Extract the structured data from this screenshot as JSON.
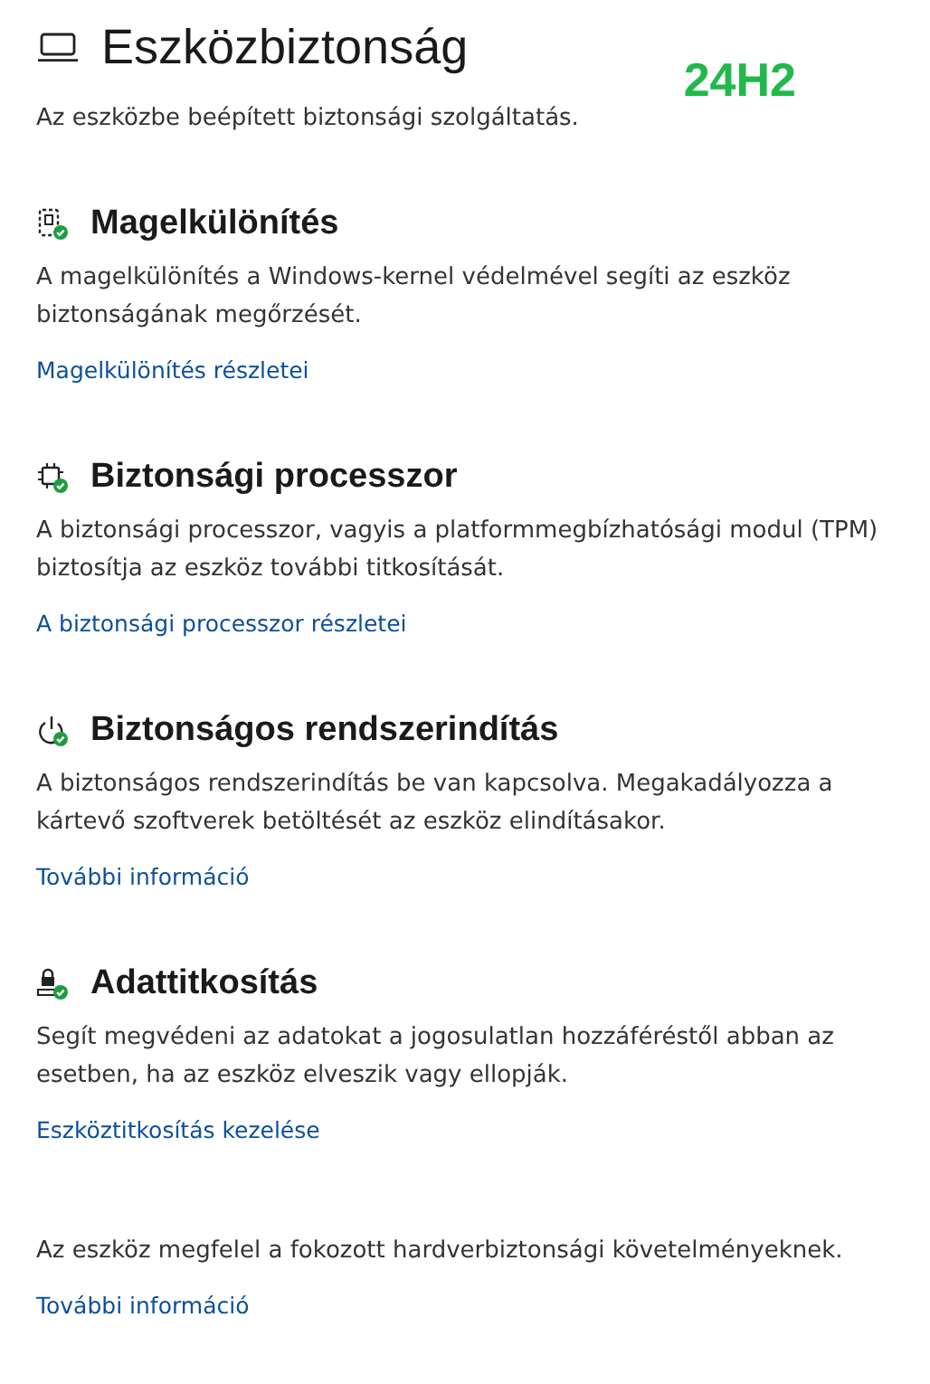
{
  "page": {
    "title": "Eszközbiztonság",
    "badge": "24H2",
    "subtitle": "Az eszközbe beépített biztonsági szolgáltatás."
  },
  "sections": [
    {
      "kind": "isolation",
      "heading": "Magelkülönítés",
      "description": "A magelkülönítés a Windows-kernel védelmével segíti az eszköz biztonságának megőrzését.",
      "link": "Magelkülönítés részletei"
    },
    {
      "kind": "processor",
      "heading": "Biztonsági processzor",
      "description": "A biztonsági processzor, vagyis a platformmegbízhatósági modul (TPM) biztosítja az eszköz további titkosítását.",
      "link": "A biztonsági processzor részletei"
    },
    {
      "kind": "boot",
      "heading": "Biztonságos rendszerindítás",
      "description": "A biztonságos rendszerindítás be van kapcsolva. Megakadályozza a kártevő szoftverek betöltését az eszköz elindításakor.",
      "link": "További információ"
    },
    {
      "kind": "encryption",
      "heading": "Adattitkosítás",
      "description": "Segít megvédeni az adatokat a jogosulatlan hozzáféréstől abban az esetben, ha az eszköz elveszik vagy ellopják.",
      "link": "Eszköztitkosítás kezelése"
    }
  ],
  "footer": {
    "text": "Az eszköz megfelel a fokozott hardverbiztonsági követelményeknek.",
    "link": "További információ"
  }
}
